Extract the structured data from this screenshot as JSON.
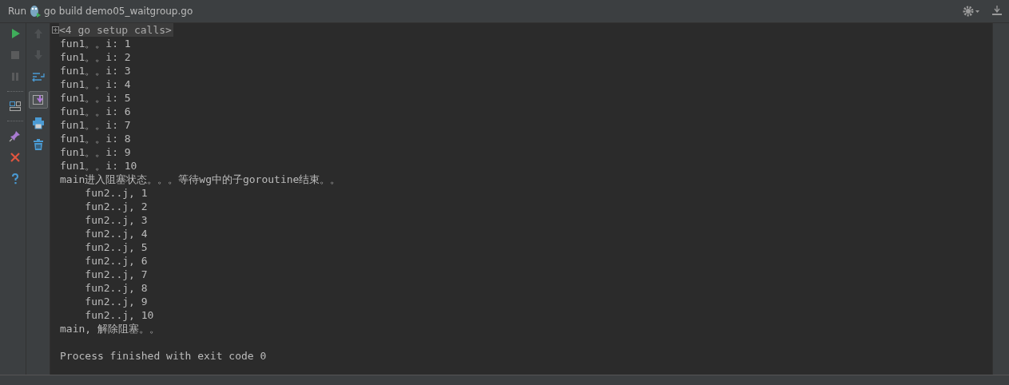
{
  "title_bar": {
    "label": "Run",
    "config": "go build demo05_waitgroup.go"
  },
  "left_tools": [
    {
      "kind": "run",
      "disabled": false
    },
    {
      "kind": "stop",
      "disabled": true
    },
    {
      "kind": "pause",
      "disabled": true
    },
    {
      "kind": "sep"
    },
    {
      "kind": "layout",
      "disabled": false
    },
    {
      "kind": "sep"
    },
    {
      "kind": "pin",
      "disabled": false
    },
    {
      "kind": "close",
      "disabled": false
    },
    {
      "kind": "help",
      "disabled": false
    }
  ],
  "right_tools": [
    {
      "kind": "up",
      "disabled": true,
      "selected": false
    },
    {
      "kind": "down",
      "disabled": true,
      "selected": false
    },
    {
      "kind": "wrap",
      "disabled": false,
      "selected": false
    },
    {
      "kind": "scroll-end",
      "disabled": false,
      "selected": true
    },
    {
      "kind": "print",
      "disabled": false,
      "selected": false
    },
    {
      "kind": "trash",
      "disabled": false,
      "selected": false
    }
  ],
  "console": [
    {
      "kind": "folded",
      "text": "<4 go setup calls>",
      "expanded": false
    },
    {
      "kind": "plain",
      "text": "fun1。。i: 1"
    },
    {
      "kind": "plain",
      "text": "fun1。。i: 2"
    },
    {
      "kind": "plain",
      "text": "fun1。。i: 3"
    },
    {
      "kind": "plain",
      "text": "fun1。。i: 4"
    },
    {
      "kind": "plain",
      "text": "fun1。。i: 5"
    },
    {
      "kind": "plain",
      "text": "fun1。。i: 6"
    },
    {
      "kind": "plain",
      "text": "fun1。。i: 7"
    },
    {
      "kind": "plain",
      "text": "fun1。。i: 8"
    },
    {
      "kind": "plain",
      "text": "fun1。。i: 9"
    },
    {
      "kind": "plain",
      "text": "fun1。。i: 10"
    },
    {
      "kind": "plain",
      "text": "main进入阻塞状态。。。等待wg中的子goroutine结束。。"
    },
    {
      "kind": "plain",
      "text": "    fun2..j, 1"
    },
    {
      "kind": "plain",
      "text": "    fun2..j, 2"
    },
    {
      "kind": "plain",
      "text": "    fun2..j, 3"
    },
    {
      "kind": "plain",
      "text": "    fun2..j, 4"
    },
    {
      "kind": "plain",
      "text": "    fun2..j, 5"
    },
    {
      "kind": "plain",
      "text": "    fun2..j, 6"
    },
    {
      "kind": "plain",
      "text": "    fun2..j, 7"
    },
    {
      "kind": "plain",
      "text": "    fun2..j, 8"
    },
    {
      "kind": "plain",
      "text": "    fun2..j, 9"
    },
    {
      "kind": "plain",
      "text": "    fun2..j, 10"
    },
    {
      "kind": "plain",
      "text": "main, 解除阻塞。。"
    },
    {
      "kind": "blank"
    },
    {
      "kind": "plain",
      "text": "Process finished with exit code 0"
    }
  ]
}
